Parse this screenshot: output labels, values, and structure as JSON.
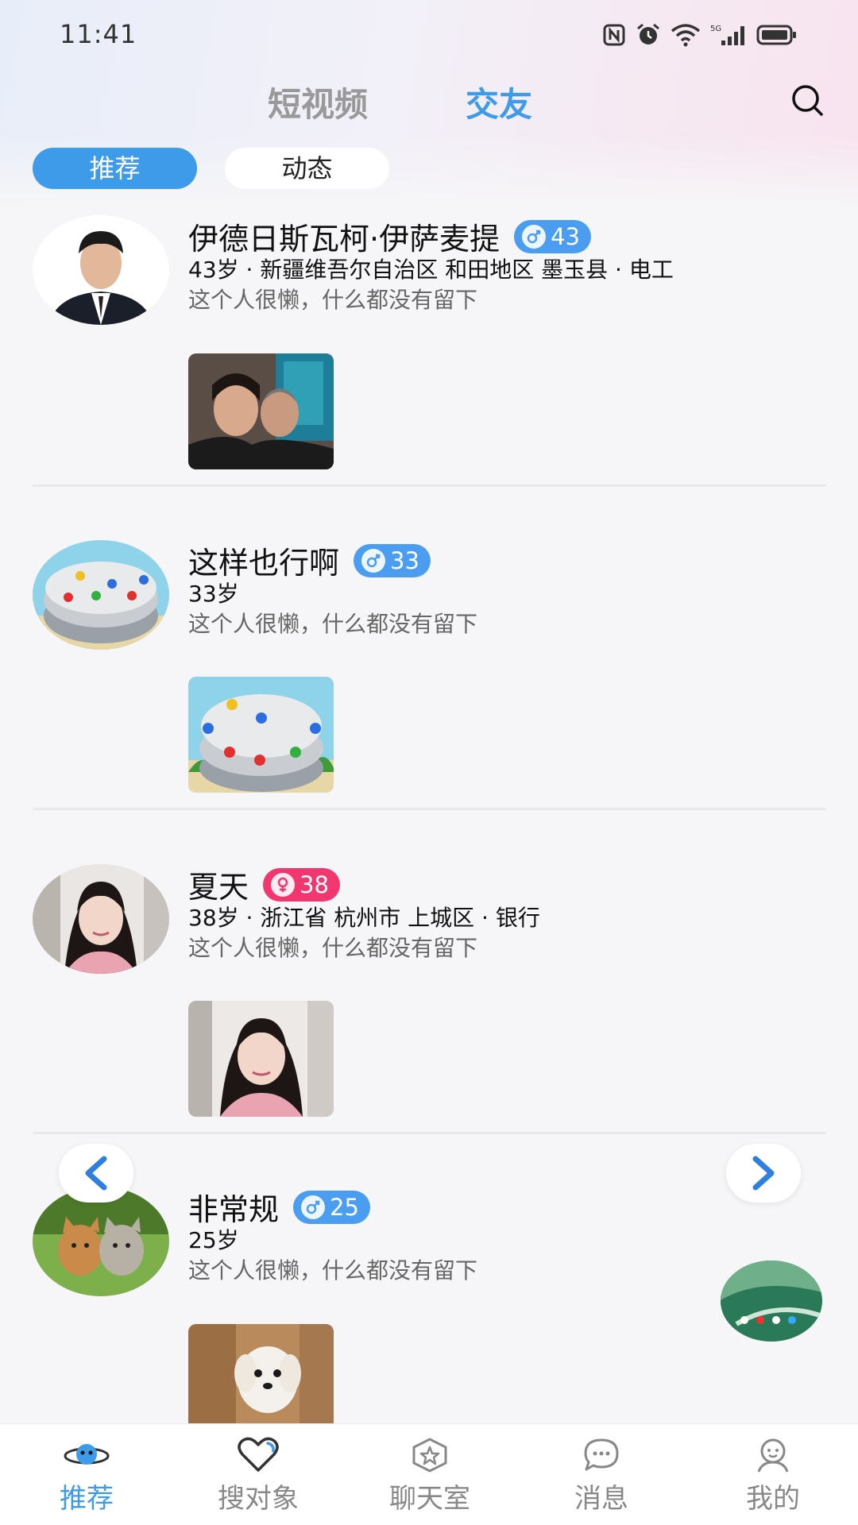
{
  "status_bar": {
    "time": "11:41",
    "network": "5G"
  },
  "header": {
    "tabs": [
      {
        "label": "短视频"
      },
      {
        "label": "交友"
      }
    ],
    "active_tab": "交友"
  },
  "sub_tabs": [
    {
      "label": "推荐"
    },
    {
      "label": "动态"
    }
  ],
  "feed": [
    {
      "name": "伊德日斯瓦柯·伊萨麦提",
      "gender": "male",
      "age": "43",
      "meta": "43岁 · 新疆维吾尔自治区 和田地区 墨玉县 · 电工",
      "bio": "这个人很懒，什么都没有留下"
    },
    {
      "name": "这样也行啊",
      "gender": "male",
      "age": "33",
      "meta": "33岁",
      "bio": "这个人很懒，什么都没有留下"
    },
    {
      "name": "夏天",
      "gender": "female",
      "age": "38",
      "meta": "38岁 · 浙江省 杭州市 上城区 · 银行",
      "bio": "这个人很懒，什么都没有留下"
    },
    {
      "name": "非常规",
      "gender": "male",
      "age": "25",
      "meta": "25岁",
      "bio": "这个人很懒，什么都没有留下"
    }
  ],
  "bottom_nav": [
    {
      "label": "推荐",
      "icon": "planet-icon",
      "active": true
    },
    {
      "label": "搜对象",
      "icon": "heart-icon",
      "active": false
    },
    {
      "label": "聊天室",
      "icon": "star-badge-icon",
      "active": false
    },
    {
      "label": "消息",
      "icon": "chat-bubble-icon",
      "active": false
    },
    {
      "label": "我的",
      "icon": "person-icon",
      "active": false
    }
  ],
  "colors": {
    "accent": "#3d9be9",
    "male_badge": "#4a9df0",
    "female_badge": "#f2366f"
  }
}
